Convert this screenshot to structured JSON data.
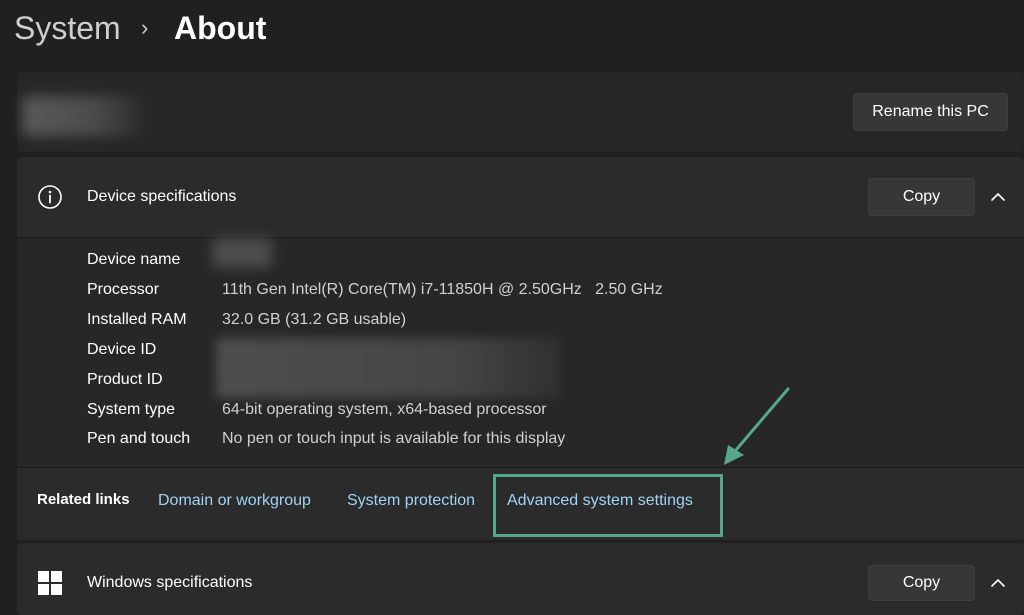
{
  "breadcrumb": {
    "parent": "System",
    "separator": "›",
    "current": "About"
  },
  "pc_card": {
    "rename_button": "Rename this PC"
  },
  "device_specs": {
    "title": "Device specifications",
    "icon": "info-icon",
    "copy_label": "Copy",
    "rows": [
      {
        "label": "Device name",
        "value": ""
      },
      {
        "label": "Processor",
        "value": "11th Gen Intel(R) Core(TM) i7-11850H @ 2.50GHz   2.50 GHz"
      },
      {
        "label": "Installed RAM",
        "value": "32.0 GB (31.2 GB usable)"
      },
      {
        "label": "Device ID",
        "value": ""
      },
      {
        "label": "Product ID",
        "value": ""
      },
      {
        "label": "System type",
        "value": "64-bit operating system, x64-based processor"
      },
      {
        "label": "Pen and touch",
        "value": "No pen or touch input is available for this display"
      }
    ]
  },
  "related_links": {
    "label": "Related links",
    "links": [
      "Domain or workgroup",
      "System protection",
      "Advanced system settings"
    ]
  },
  "windows_specs": {
    "title": "Windows specifications",
    "icon": "windows-logo-icon",
    "copy_label": "Copy"
  },
  "colors": {
    "background": "#202020",
    "card": "#2b2b2b",
    "link": "#9ed4f5",
    "annotation": "#55a98a"
  }
}
